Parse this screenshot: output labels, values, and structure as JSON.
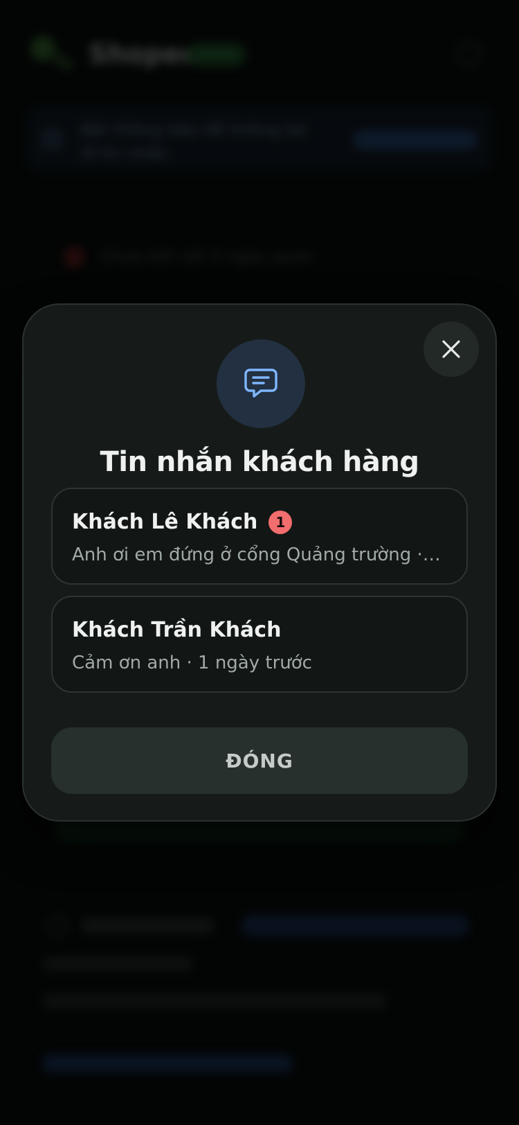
{
  "background": {
    "brand": "Shopee",
    "status_pill": "Online",
    "banner_text": "Bật thông báo để không bỏ lỡ tin nhắn",
    "alert_text": "Chưa kết nối 3 ngày quan"
  },
  "modal": {
    "title": "Tin nhắn khách hàng",
    "icon": "chat-bubble-icon",
    "close_icon": "close-icon",
    "conversations": [
      {
        "name": "Khách Lê Khách",
        "badge": "1",
        "preview": "Anh ơi em đứng ở cổng Quảng trường · vừa xong"
      },
      {
        "name": "Khách Trần Khách",
        "badge": "",
        "preview": "Cảm ơn anh · 1 ngày trước"
      }
    ],
    "close_button_label": "ĐÓNG"
  },
  "colors": {
    "accent_icon": "#7fb6ff",
    "badge": "#f26d6d",
    "modal_bg": "#161b19"
  }
}
